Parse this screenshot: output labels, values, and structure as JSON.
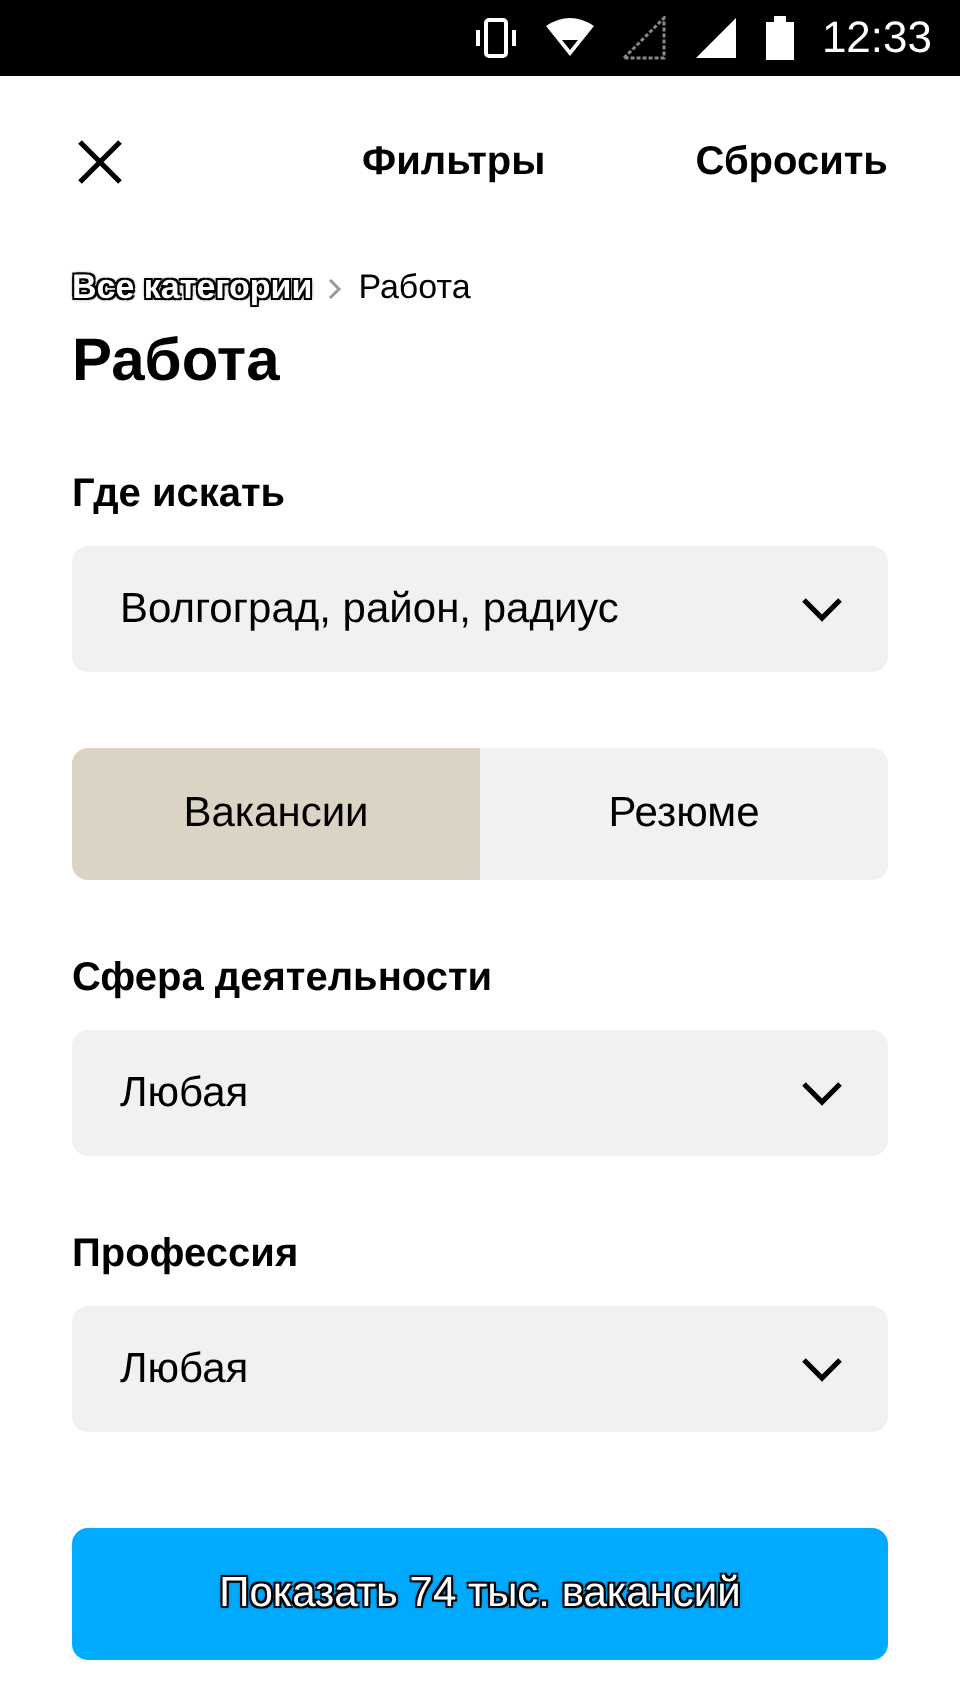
{
  "status_bar": {
    "time": "12:33"
  },
  "header": {
    "title": "Фильтры",
    "reset": "Сбросить"
  },
  "breadcrumb": [
    {
      "label": "Все категории",
      "kind": "link"
    },
    {
      "label": "Работа",
      "kind": "current"
    }
  ],
  "page_title": "Работа",
  "location": {
    "label": "Где искать",
    "value": "Волгоград, район, радиус"
  },
  "segments": [
    {
      "label": "Вакансии",
      "selected": true
    },
    {
      "label": "Резюме",
      "selected": false
    }
  ],
  "filters": [
    {
      "label": "Сфера деятельности",
      "value": "Любая"
    },
    {
      "label": "Профессия",
      "value": "Любая"
    }
  ],
  "show_button": "Показать 74 тыс. вакансий"
}
